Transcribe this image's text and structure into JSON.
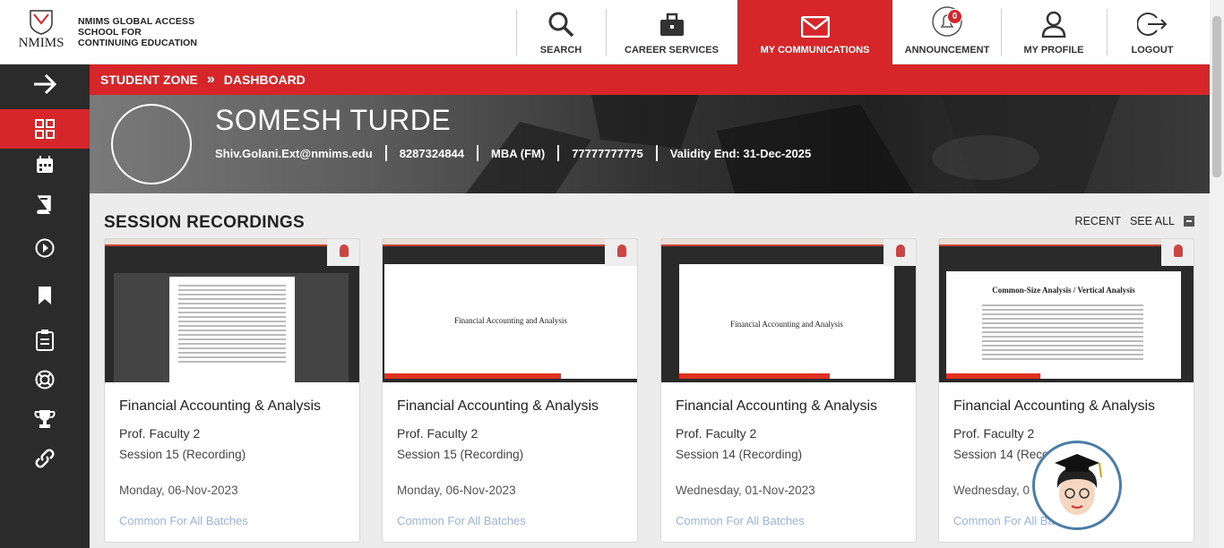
{
  "header": {
    "logo_text": "NMIMS",
    "school_lines": [
      "NMIMS GLOBAL ACCESS",
      "SCHOOL FOR",
      "CONTINUING EDUCATION"
    ],
    "nav": [
      {
        "label": "SEARCH",
        "icon": "search-icon"
      },
      {
        "label": "CAREER SERVICES",
        "icon": "briefcase-icon"
      },
      {
        "label": "MY COMMUNICATIONS",
        "icon": "mail-icon",
        "active": true
      },
      {
        "label": "ANNOUNCEMENT",
        "icon": "bell-icon",
        "badge": "0"
      },
      {
        "label": "MY PROFILE",
        "icon": "user-icon"
      },
      {
        "label": "LOGOUT",
        "icon": "logout-icon"
      }
    ],
    "accent": "#d7262a"
  },
  "breadcrumb": {
    "root": "STUDENT ZONE",
    "current": "DASHBOARD"
  },
  "profile": {
    "name": "SOMESH TURDE",
    "email": "Shiv.Golani.Ext@nmims.edu",
    "phone": "8287324844",
    "program": "MBA (FM)",
    "id": "77777777775",
    "validity": "Validity End: 31-Dec-2025"
  },
  "sidebar": {
    "items": [
      "arrow-right-icon",
      "dashboard-grid-icon",
      "calendar-icon",
      "book-icon",
      "play-icon",
      "bookmark-icon",
      "clipboard-icon",
      "lifebuoy-icon",
      "trophy-icon",
      "link-icon"
    ]
  },
  "recordings": {
    "title": "SESSION RECORDINGS",
    "recent_label": "RECENT",
    "see_all_label": "SEE ALL",
    "cards": [
      {
        "title": "Financial Accounting & Analysis",
        "faculty": "Prof. Faculty 2",
        "session": "Session 15 (Recording)",
        "date": "Monday, 06-Nov-2023",
        "batch": "Common For All Batches",
        "thumb_text": ""
      },
      {
        "title": "Financial Accounting & Analysis",
        "faculty": "Prof. Faculty 2",
        "session": "Session 15 (Recording)",
        "date": "Monday, 06-Nov-2023",
        "batch": "Common For All Batches",
        "thumb_text": "Financial Accounting and Analysis"
      },
      {
        "title": "Financial Accounting & Analysis",
        "faculty": "Prof. Faculty 2",
        "session": "Session 14 (Recording)",
        "date": "Wednesday, 01-Nov-2023",
        "batch": "Common For All Batches",
        "thumb_text": "Financial Accounting and Analysis"
      },
      {
        "title": "Financial Accounting & Analysis",
        "faculty": "Prof. Faculty 2",
        "session": "Session 14 (Reco",
        "date": "Wednesday, 0",
        "batch": "Common For All Ba",
        "thumb_text": "Common-Size Analysis / Vertical Analysis"
      }
    ]
  }
}
